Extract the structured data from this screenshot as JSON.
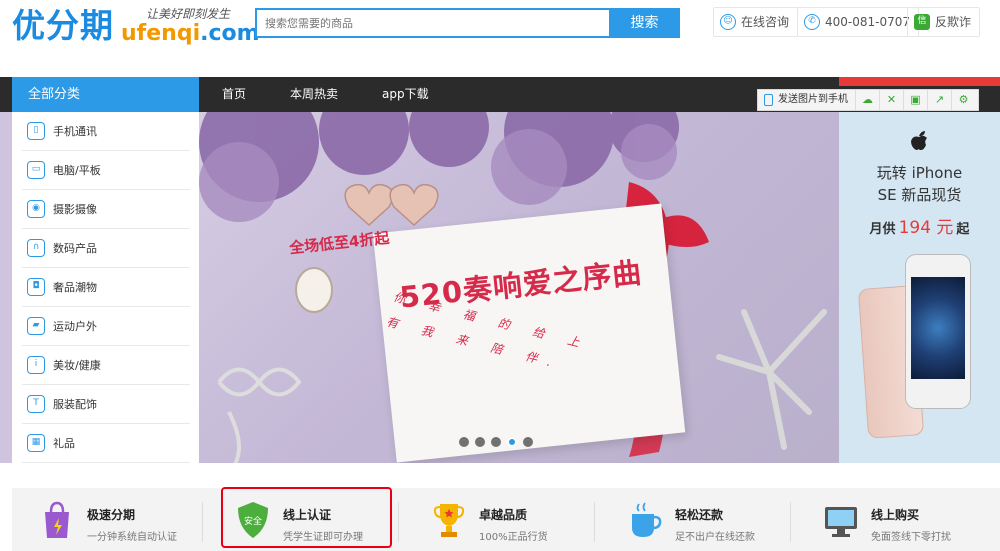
{
  "header": {
    "logo_cn": "优分期",
    "logo_slogan": "让美好即刻发生",
    "logo_en_main": "ufenqi",
    "logo_en_tld": ".com",
    "search_placeholder": "搜索您需要的商品",
    "search_button": "搜索",
    "online_consult": "在线咨询",
    "phone": "400-081-0707",
    "anti_fraud": "反欺诈",
    "anti_fraud_icon_glyph": "信"
  },
  "nav": {
    "all_categories": "全部分类",
    "items": [
      "首页",
      "本周热卖",
      "app下载"
    ]
  },
  "toolbar": {
    "send_to_phone": "发送图片到手机"
  },
  "categories": [
    {
      "label": "手机通讯",
      "icon": "mobile-icon"
    },
    {
      "label": "电脑/平板",
      "icon": "computer-icon"
    },
    {
      "label": "摄影摄像",
      "icon": "camera-icon"
    },
    {
      "label": "数码产品",
      "icon": "headphones-icon"
    },
    {
      "label": "奢品潮物",
      "icon": "bag-icon"
    },
    {
      "label": "运动户外",
      "icon": "sneaker-icon"
    },
    {
      "label": "美妆/健康",
      "icon": "info-icon"
    },
    {
      "label": "服装配饰",
      "icon": "shirt-icon"
    },
    {
      "label": "礼品",
      "icon": "gift-icon"
    }
  ],
  "banner": {
    "subtitle": "全场低至4折起",
    "title": "520奏响爱之序曲",
    "script_line1": "你 幸 福 的 给 上",
    "script_line2": "有 我 来 陪 伴.",
    "slides": 5,
    "active_slide": 4
  },
  "promo": {
    "line1": "玩转 iPhone",
    "line2": "SE 新品现货",
    "monthly_prefix": "月供",
    "monthly_price": "194 元",
    "monthly_suffix": "起"
  },
  "features": [
    {
      "title": "极速分期",
      "desc": "一分钟系统自动认证",
      "icon": "shopping-bag-icon"
    },
    {
      "title": "线上认证",
      "desc": "凭学生证即可办理",
      "icon": "shield-icon",
      "badge": "安全"
    },
    {
      "title": "卓越品质",
      "desc": "100%正品行货",
      "icon": "trophy-icon"
    },
    {
      "title": "轻松还款",
      "desc": "足不出户在线还款",
      "icon": "cup-icon"
    },
    {
      "title": "线上购买",
      "desc": "免面签线下零打扰",
      "icon": "monitor-icon"
    }
  ],
  "colors": {
    "brand_blue": "#2d9ae8",
    "brand_orange": "#f39800",
    "accent_red": "#e93a3a",
    "navbar": "#2b2b2b"
  }
}
